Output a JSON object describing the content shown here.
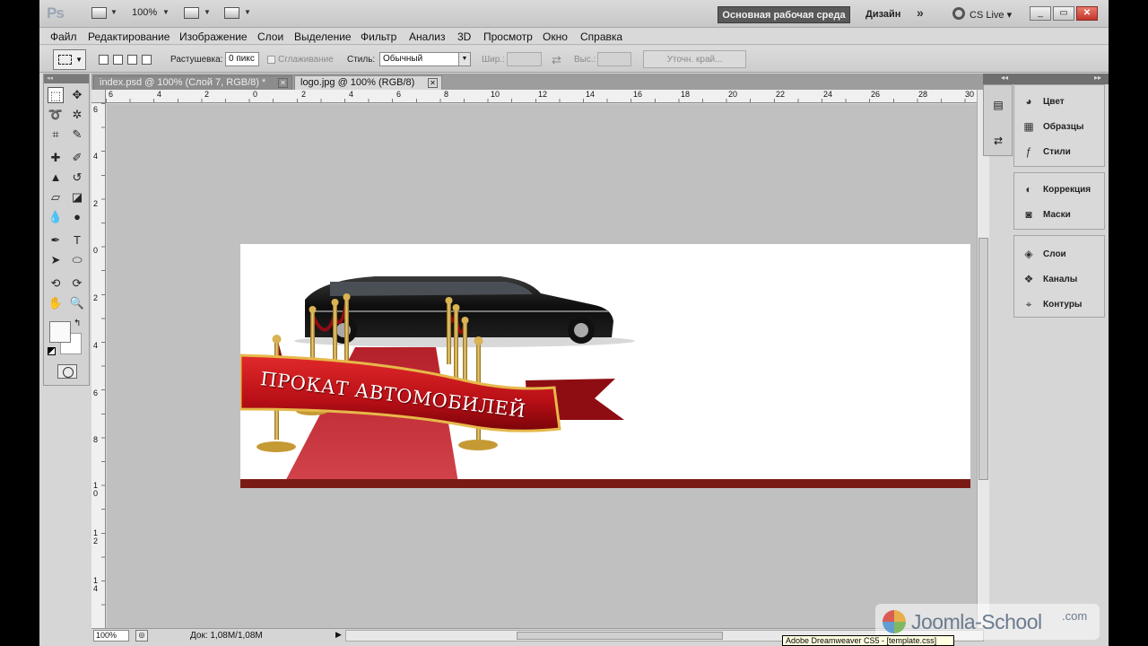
{
  "app": {
    "logo": "Ps",
    "zoom": "100%",
    "workspace_active": "Основная рабочая среда",
    "workspace_design": "Дизайн",
    "more": "»",
    "cs_live": "CS Live",
    "win_min": "_",
    "win_max": "▭",
    "win_close": "✕"
  },
  "menu": [
    "Файл",
    "Редактирование",
    "Изображение",
    "Слои",
    "Выделение",
    "Фильтр",
    "Анализ",
    "3D",
    "Просмотр",
    "Окно",
    "Справка"
  ],
  "options": {
    "feather_label": "Растушевка:",
    "feather_value": "0 пикс",
    "antialias_label": "Сглаживание",
    "style_label": "Стиль:",
    "style_value": "Обычный",
    "width_label": "Шир.:",
    "height_label": "Выс.:",
    "refine_edge": "Уточн. край..."
  },
  "tabs": [
    {
      "label": "index.psd @ 100% (Слой 7, RGB/8) *",
      "active": false
    },
    {
      "label": "logo.jpg @ 100% (RGB/8)",
      "active": true
    }
  ],
  "ruler": {
    "h": [
      "6",
      "4",
      "2",
      "0",
      "2",
      "4",
      "6",
      "8",
      "10",
      "12",
      "14",
      "16",
      "18",
      "20",
      "22",
      "24",
      "26",
      "28",
      "30"
    ],
    "v": [
      "6",
      "4",
      "2",
      "0",
      "2",
      "4",
      "6",
      "8",
      "1 0",
      "1 2",
      "1 4"
    ]
  },
  "document": {
    "banner_text": "ПРОКАТ АВТОМОБИЛЕЙ"
  },
  "status": {
    "zoom": "100%",
    "doc_info": "Док: 1,08M/1,08M"
  },
  "panels": {
    "group1": [
      {
        "icon": "color-panel-icon",
        "label": "Цвет"
      },
      {
        "icon": "swatches-panel-icon",
        "label": "Образцы"
      },
      {
        "icon": "styles-panel-icon",
        "label": "Стили"
      }
    ],
    "group2": [
      {
        "icon": "adjustments-panel-icon",
        "label": "Коррекция"
      },
      {
        "icon": "masks-panel-icon",
        "label": "Маски"
      }
    ],
    "group3": [
      {
        "icon": "layers-panel-icon",
        "label": "Слои"
      },
      {
        "icon": "channels-panel-icon",
        "label": "Каналы"
      },
      {
        "icon": "paths-panel-icon",
        "label": "Контуры"
      }
    ]
  },
  "taskbar_tooltip": "Adobe Dreamweaver CS5 - [template.css]",
  "watermark": {
    "name": "Joomla-School",
    "suffix": ".com"
  },
  "colors": {
    "workspace_button": "#595959",
    "ribbon_red": "#c8141c",
    "carpet_red": "#c8323c",
    "gold": "#c9a13a"
  }
}
